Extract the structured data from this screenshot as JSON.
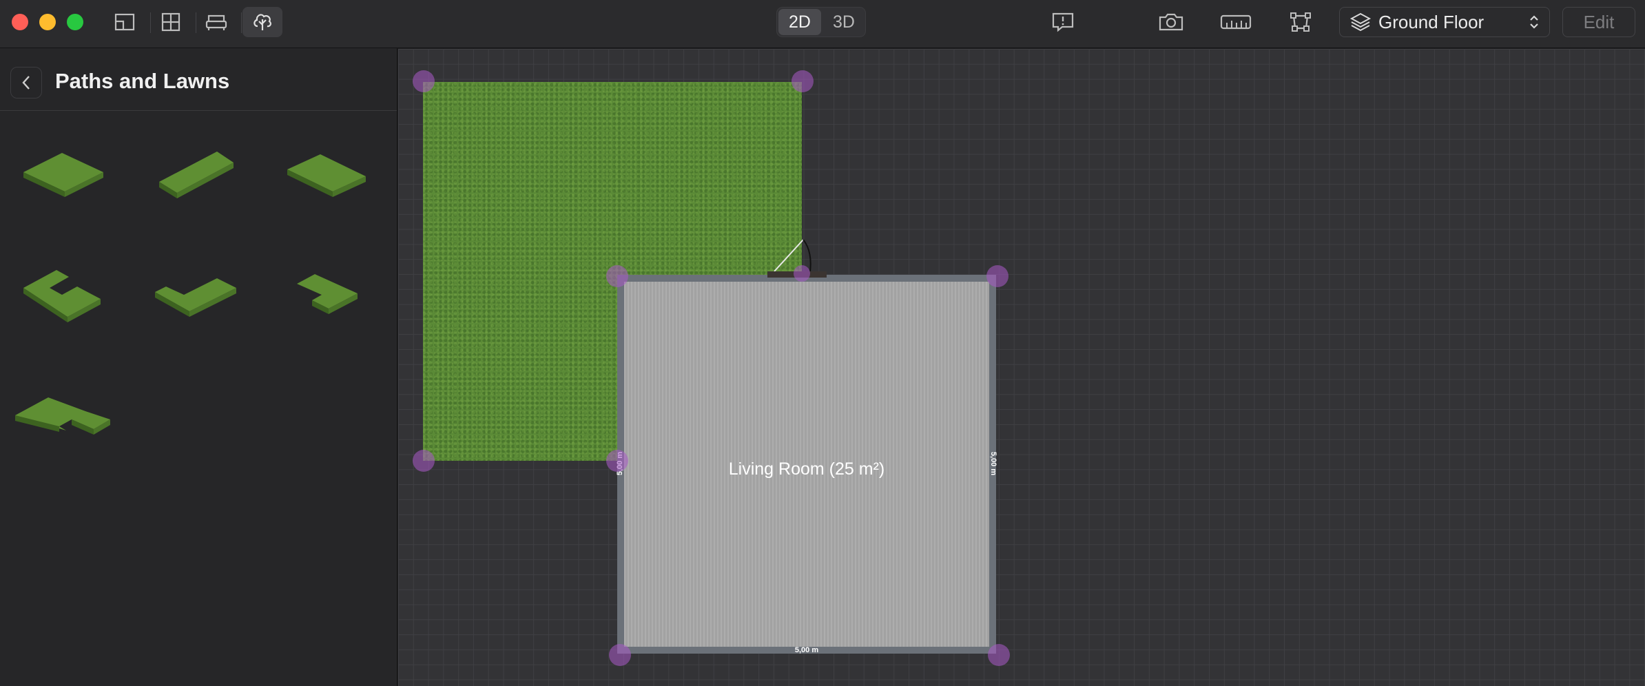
{
  "window": {
    "controls": [
      "close",
      "minimize",
      "zoom"
    ]
  },
  "toolbar": {
    "left_tools": [
      {
        "icon": "floorplan-icon"
      },
      {
        "icon": "window-grid-icon"
      },
      {
        "icon": "sofa-icon"
      },
      {
        "icon": "tree-icon",
        "active": true
      }
    ],
    "view_modes": [
      {
        "label": "2D",
        "selected": true
      },
      {
        "label": "3D",
        "selected": false
      }
    ],
    "right_tools": [
      {
        "icon": "feedback-icon"
      },
      {
        "icon": "camera-icon"
      },
      {
        "icon": "ruler-icon"
      },
      {
        "icon": "transform-icon"
      }
    ],
    "floor": {
      "icon": "layers-icon",
      "label": "Ground Floor"
    },
    "edit_label": "Edit"
  },
  "sidebar": {
    "title": "Paths and Lawns",
    "items": [
      {
        "shape": "rectangle-lawn"
      },
      {
        "shape": "narrow-rectangle-lawn"
      },
      {
        "shape": "wide-rectangle-lawn"
      },
      {
        "shape": "l-shape-lawn"
      },
      {
        "shape": "u-shape-lawn"
      },
      {
        "shape": "notched-lawn"
      },
      {
        "shape": "large-l-shape-lawn"
      }
    ]
  },
  "canvas": {
    "room": {
      "label": "Living Room (25 m²)",
      "dim_bottom": "5,00 m",
      "dim_left": "5,00 m",
      "dim_right": "5,00 m"
    },
    "colors": {
      "lawn": "#5a8a36",
      "room_wall": "#6b7179",
      "room_floor": "#a9a9a9",
      "handle": "#aa5ac8"
    }
  }
}
